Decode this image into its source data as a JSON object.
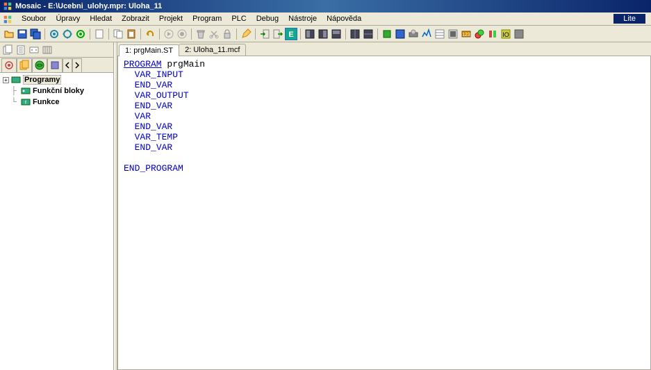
{
  "titlebar": {
    "text": "Mosaic - E:\\Ucebni_ulohy.mpr: Uloha_11"
  },
  "menus": {
    "soubor": "Soubor",
    "upravy": "Úpravy",
    "hledat": "Hledat",
    "zobrazit": "Zobrazit",
    "projekt": "Projekt",
    "program": "Program",
    "plc": "PLC",
    "debug": "Debug",
    "nastroje": "Nástroje",
    "napoveda": "Nápověda"
  },
  "lite_label": "Lite",
  "tree": {
    "programy": "Programy",
    "funkcni_bloky": "Funkční bloky",
    "funkce": "Funkce"
  },
  "tabs": {
    "t1": "1: prgMain.ST",
    "t2": "2: Uloha_11.mcf"
  },
  "code": {
    "program": "PROGRAM",
    "name": " prgMain",
    "var_input": "VAR_INPUT",
    "end_var1": "END_VAR",
    "var_output": "VAR_OUTPUT",
    "end_var2": "END_VAR",
    "var": "VAR",
    "end_var3": "END_VAR",
    "var_temp": "VAR_TEMP",
    "end_var4": "END_VAR",
    "end_program": "END_PROGRAM"
  }
}
